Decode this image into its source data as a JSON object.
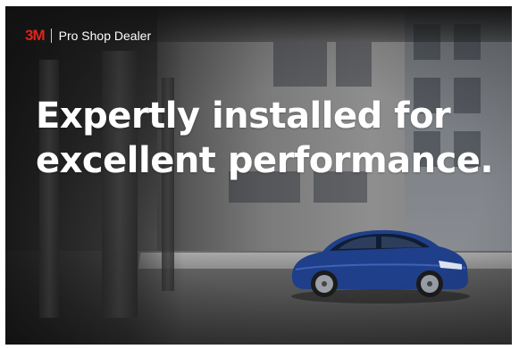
{
  "logo": {
    "brand": "3M",
    "text": "Pro Shop Dealer"
  },
  "headline": {
    "line1": "Expertly installed for",
    "line2": "excellent performance."
  },
  "colors": {
    "brand_red": "#e2231a",
    "headline": "#ffffff",
    "car_blue": "#1f3f8a"
  },
  "icons": {
    "car": "car-image"
  }
}
